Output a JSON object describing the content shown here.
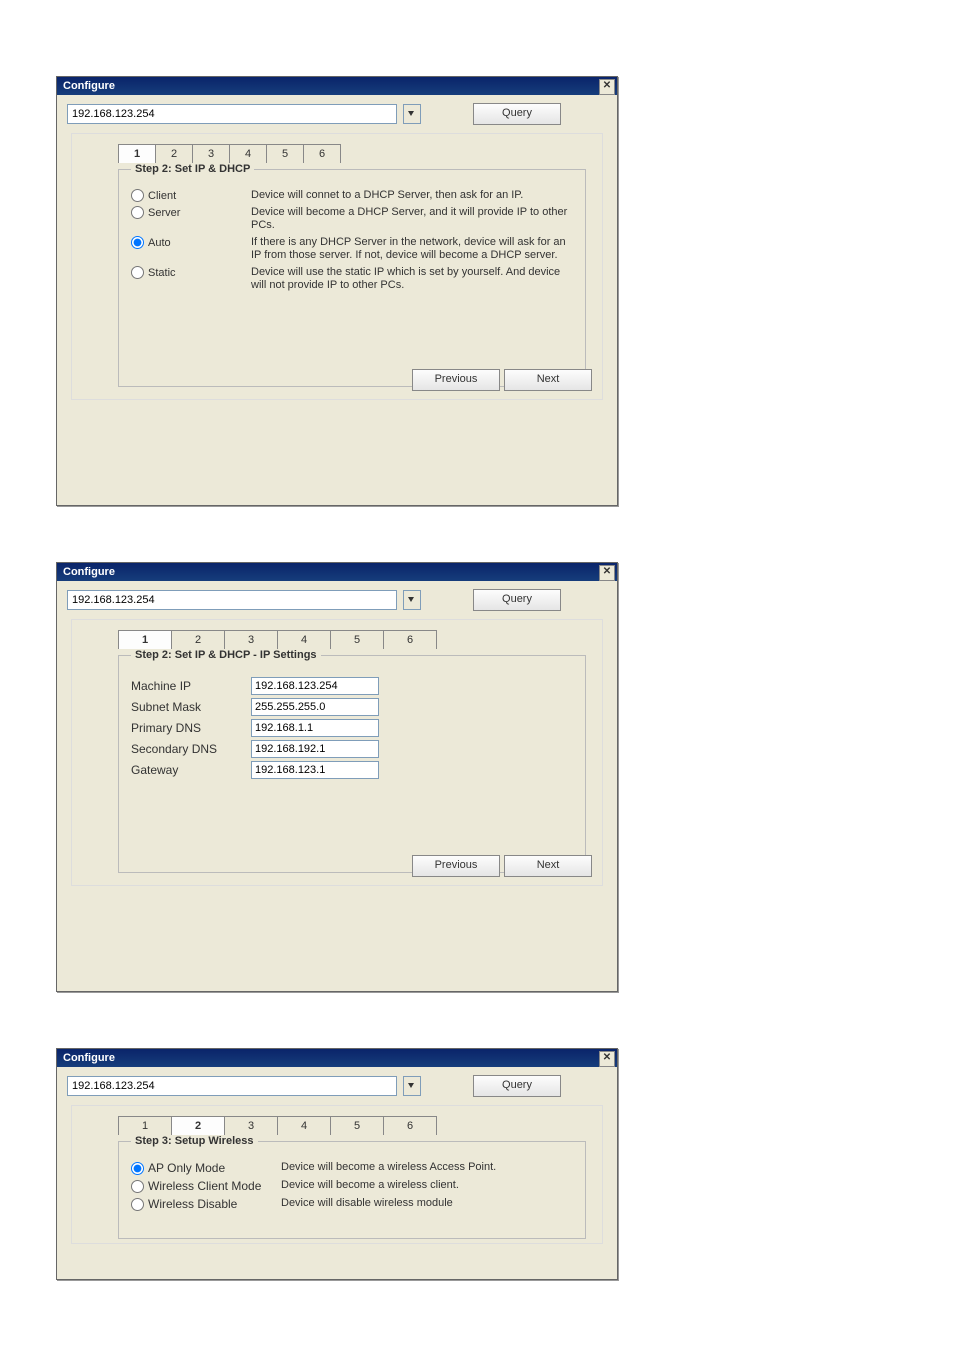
{
  "dialogs": [
    {
      "title": "Configure",
      "address": "192.168.123.254",
      "query": "Query",
      "tabs": [
        "1",
        "2",
        "3",
        "4",
        "5",
        "6"
      ],
      "active_tab": 1,
      "step_legend": "Step 2: Set IP & DHCP",
      "options": [
        {
          "name": "Client",
          "desc": "Device will connet to a DHCP Server, then ask for an IP.",
          "sel": false
        },
        {
          "name": "Server",
          "desc": "Device will become a DHCP Server, and it will provide IP to other PCs.",
          "sel": false
        },
        {
          "name": "Auto",
          "desc": "If there is any DHCP Server in the network, device will ask for an IP from those server. If not, device will become a DHCP server.",
          "sel": true
        },
        {
          "name": "Static",
          "desc": "Device will use the static IP which is set by yourself. And device will not provide IP to other PCs.",
          "sel": false
        }
      ],
      "prev": "Previous",
      "next": "Next"
    },
    {
      "title": "Configure",
      "address": "192.168.123.254",
      "query": "Query",
      "tabs": [
        "1",
        "2",
        "3",
        "4",
        "5",
        "6"
      ],
      "active_tab": 1,
      "step_legend": "Step 2: Set IP & DHCP - IP Settings",
      "fields": [
        {
          "label": "Machine IP",
          "value": "192.168.123.254"
        },
        {
          "label": "Subnet Mask",
          "value": "255.255.255.0"
        },
        {
          "label": "Primary DNS",
          "value": "192.168.1.1"
        },
        {
          "label": "Secondary DNS",
          "value": "192.168.192.1"
        },
        {
          "label": "Gateway",
          "value": "192.168.123.1"
        }
      ],
      "prev": "Previous",
      "next": "Next"
    },
    {
      "title": "Configure",
      "address": "192.168.123.254",
      "query": "Query",
      "tabs": [
        "1",
        "2",
        "3",
        "4",
        "5",
        "6"
      ],
      "active_tab": 2,
      "step_legend": "Step 3: Setup Wireless",
      "options": [
        {
          "name": "AP Only Mode",
          "desc": "Device will become a wireless Access Point.",
          "sel": true
        },
        {
          "name": "Wireless Client Mode",
          "desc": "Device will become a wireless client.",
          "sel": false
        },
        {
          "name": "Wireless Disable",
          "desc": "Device will disable wireless module",
          "sel": false
        }
      ]
    }
  ]
}
